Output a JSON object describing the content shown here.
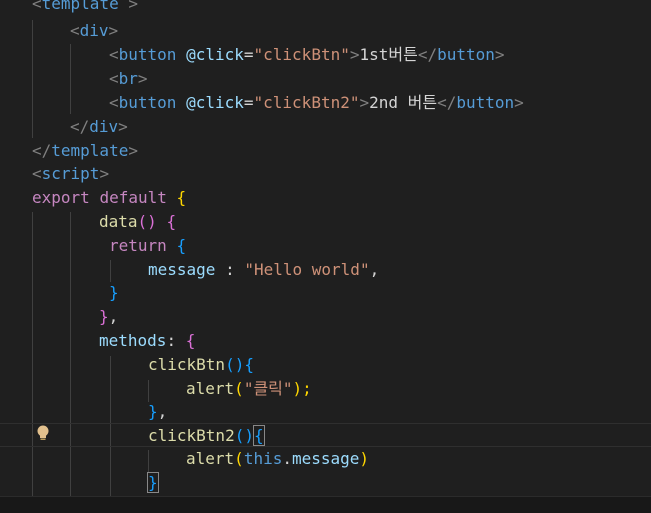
{
  "editor": {
    "language": "vue",
    "colors": {
      "background": "#1f1f1f",
      "tag": "#569cd6",
      "bracket": "#808080",
      "attribute": "#9cdcfe",
      "string": "#ce9178",
      "keyword": "#c586c0",
      "function": "#dcdcaa",
      "bracket_gold": "#ffd700",
      "bracket_purple": "#da70d6",
      "bracket_blue": "#179fff"
    },
    "lightbulb_icon": "lightbulb-icon",
    "lines": {
      "l0": {
        "a": "<",
        "b": "template",
        "c": " >"
      },
      "l1": {
        "a": "<",
        "b": "div",
        "c": ">"
      },
      "l2": {
        "a": "<",
        "b": "button",
        "c": " ",
        "d": "@click",
        "e": "=",
        "f": "\"clickBtn\"",
        "g": ">",
        "h": "1st버튼",
        "i": "</",
        "j": "button",
        "k": ">"
      },
      "l3": {
        "a": "<",
        "b": "br",
        "c": ">"
      },
      "l4": {
        "a": "<",
        "b": "button",
        "c": " ",
        "d": "@click",
        "e": "=",
        "f": "\"clickBtn2\"",
        "g": ">",
        "h": "2nd 버튼",
        "i": "</",
        "j": "button",
        "k": ">"
      },
      "l5": {
        "a": "</",
        "b": "div",
        "c": ">"
      },
      "l6": {
        "a": "</",
        "b": "template",
        "c": ">"
      },
      "l7": {
        "a": "<",
        "b": "script",
        "c": ">"
      },
      "l8": {
        "a": "export",
        "b": " ",
        "c": "default",
        "d": " ",
        "e": "{"
      },
      "l9": {
        "a": "data",
        "b": "()",
        "c": " ",
        "d": "{"
      },
      "l10": {
        "a": "return",
        "b": " ",
        "c": "{"
      },
      "l11": {
        "a": "message",
        "b": " : ",
        "c": "\"Hello world\"",
        "d": ","
      },
      "l12": {
        "a": "}"
      },
      "l13": {
        "a": "}",
        "b": ","
      },
      "l14": {
        "a": "methods",
        "b": ": ",
        "c": "{"
      },
      "l15": {
        "a": "clickBtn",
        "b": "()",
        "c": "{"
      },
      "l16": {
        "a": "alert",
        "b": "(",
        "c": "\"클릭\"",
        "d": ");"
      },
      "l17": {
        "a": "}",
        "b": ","
      },
      "l18": {
        "a": "clickBtn2",
        "b": "()",
        "c": "{"
      },
      "l19": {
        "a": "alert",
        "b": "(",
        "c": "this",
        "d": ".",
        "e": "message",
        "f": ")"
      },
      "l20": {
        "a": "}"
      }
    }
  }
}
